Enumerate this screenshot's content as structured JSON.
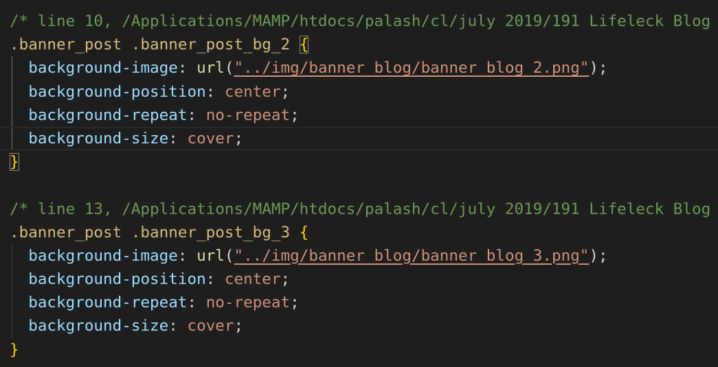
{
  "editor": {
    "blocks": [
      {
        "comment": "/* line 10, /Applications/MAMP/htdocs/palash/cl/july 2019/191 Lifeleck Blog",
        "selector": ".banner_post .banner_post_bg_2",
        "open_brace": "{",
        "close_brace": "}",
        "declarations": [
          {
            "property": "background-image",
            "func": "url",
            "value": "\"../img/banner_blog/banner_blog_2.png\""
          },
          {
            "property": "background-position",
            "value": "center"
          },
          {
            "property": "background-repeat",
            "value": "no-repeat"
          },
          {
            "property": "background-size",
            "value": "cover"
          }
        ]
      },
      {
        "comment": "/* line 13, /Applications/MAMP/htdocs/palash/cl/july 2019/191 Lifeleck Blog",
        "selector": ".banner_post .banner_post_bg_3",
        "open_brace": "{",
        "close_brace": "}",
        "declarations": [
          {
            "property": "background-image",
            "func": "url",
            "value": "\"../img/banner_blog/banner_blog_3.png\""
          },
          {
            "property": "background-position",
            "value": "center"
          },
          {
            "property": "background-repeat",
            "value": "no-repeat"
          },
          {
            "property": "background-size",
            "value": "cover"
          }
        ]
      }
    ],
    "punctuation": {
      "colon": ": ",
      "semicolon": ";",
      "open_paren": "(",
      "close_paren": ")"
    },
    "colors": {
      "background": "#1e1e1e",
      "comment": "#6a9955",
      "selector": "#d7ba7d",
      "brace": "#ffd700",
      "property": "#9cdcfe",
      "value": "#ce9178",
      "function": "#dcdcaa"
    }
  }
}
